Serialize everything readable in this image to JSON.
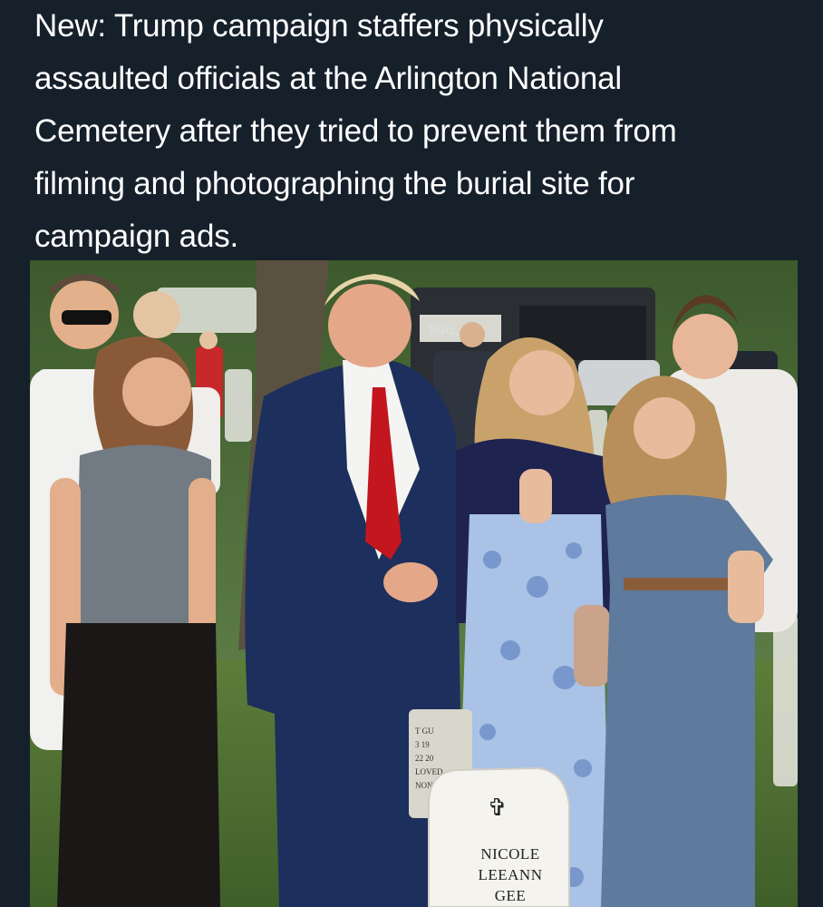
{
  "post": {
    "text": "New: Trump campaign staffers physically\nassaulted officials at the Arlington National\nCemetery after they tried to prevent them from\nfilming and photographing the burial site for\ncampaign ads."
  },
  "photo": {
    "headstone_cross": "✞",
    "headstone_lines": [
      "NICOLE",
      "LEEANN",
      "GEE"
    ],
    "background_stone_lines": [
      "T GU",
      "3 19",
      "22 20",
      "LOVED",
      "NON"
    ],
    "bus_sign": "MAL"
  },
  "colors": {
    "background": "#15202b",
    "text": "#ffffff"
  }
}
